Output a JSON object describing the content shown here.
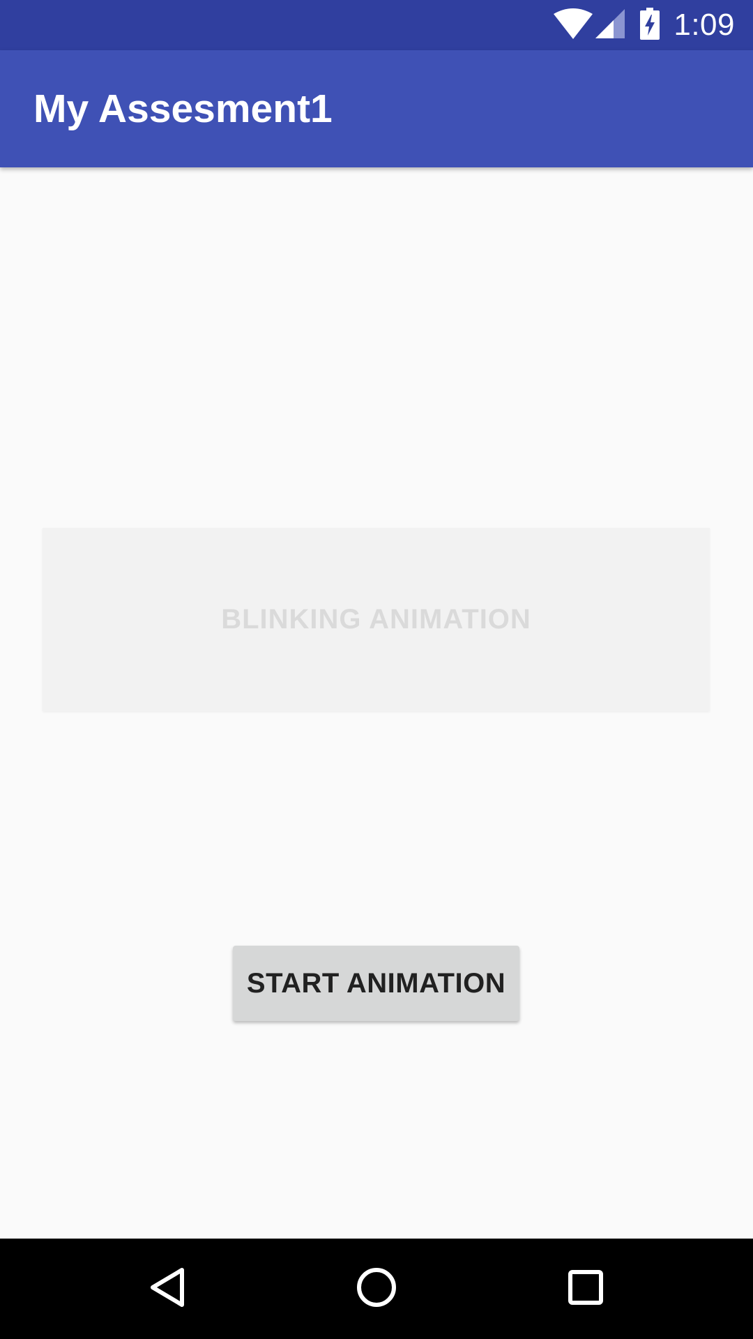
{
  "status_bar": {
    "time": "1:09",
    "icons": [
      "wifi-icon",
      "signal-icon",
      "battery-charging-icon"
    ]
  },
  "app_bar": {
    "title": "My Assesment1"
  },
  "main": {
    "blink_text": "BLINKING ANIMATION",
    "start_button_label": "START ANIMATION"
  },
  "nav_bar": {
    "icons": [
      "back-icon",
      "home-icon",
      "recents-icon"
    ]
  },
  "colors": {
    "status_bar": "#303f9f",
    "app_bar": "#3f51b5",
    "background": "#fafafa",
    "button": "#d6d7d7"
  }
}
